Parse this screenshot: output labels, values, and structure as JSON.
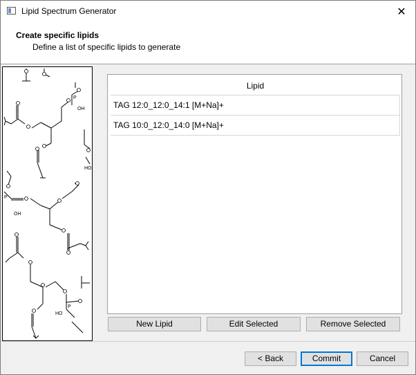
{
  "window": {
    "title": "Lipid Spectrum Generator",
    "close_glyph": "✕"
  },
  "header": {
    "title": "Create specific lipids",
    "subtitle": "Define a list of specific lipids to generate"
  },
  "art": {
    "description_icon": "molecule-structure-icon",
    "labels": [
      "OH",
      "OH",
      "HO",
      "OH",
      "HO",
      "P",
      "P",
      "P"
    ]
  },
  "grid": {
    "column_header": "Lipid",
    "rows": [
      "TAG 12:0_12:0_14:1 [M+Na]+",
      "TAG 10:0_12:0_14:0 [M+Na]+"
    ]
  },
  "actions": {
    "new_label": "New Lipid",
    "edit_label": "Edit Selected",
    "remove_label": "Remove Selected"
  },
  "footer": {
    "back_label": "< Back",
    "commit_label": "Commit",
    "cancel_label": "Cancel"
  }
}
